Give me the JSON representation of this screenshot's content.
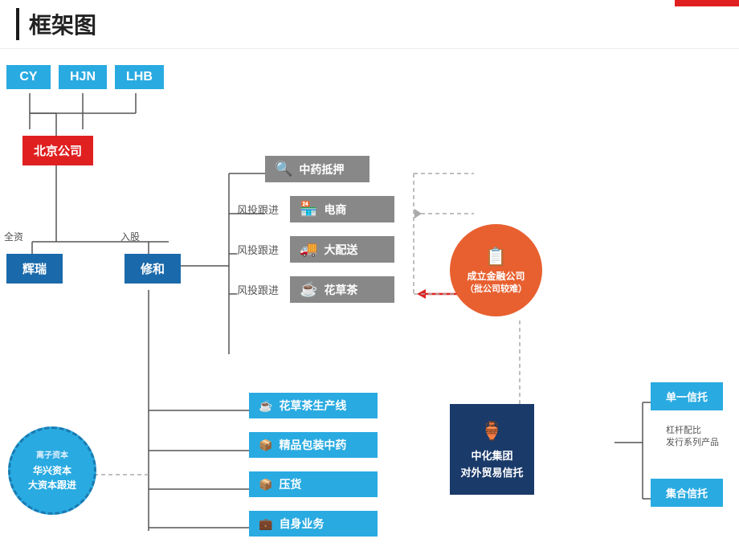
{
  "header": {
    "title": "框架图",
    "accent_color": "#e02020"
  },
  "top_labels": [
    "CY",
    "HJN",
    "LHB"
  ],
  "beijing_box": "北京公司",
  "subsidiaries": {
    "huirui": "辉瑞",
    "xiuhe": "修和",
    "quanzi": "全资",
    "rugu": "入股"
  },
  "business_rows": [
    {
      "label": "",
      "name": "中药抵押",
      "icon": "🔍"
    },
    {
      "label": "风投跟进",
      "name": "电商",
      "icon": "🏪"
    },
    {
      "label": "风投跟进",
      "name": "大配送",
      "icon": "🚚"
    },
    {
      "label": "风投跟进",
      "name": "花草茶",
      "icon": "☕"
    }
  ],
  "bottom_business": [
    {
      "name": "花草茶生产线",
      "icon": "☕"
    },
    {
      "name": "精品包装中药",
      "icon": "📦"
    },
    {
      "name": "压货",
      "icon": "📦"
    },
    {
      "name": "自身业务",
      "icon": "💼"
    }
  ],
  "finance_circle": {
    "icon": "📋",
    "line1": "成立金融公司",
    "line2": "（批公司较难）"
  },
  "huaxing_circle": {
    "line1": "华兴资本",
    "line2": "大资本跟进",
    "subtitle": "离子资本"
  },
  "zhonghua_box": {
    "name": "中化集团\n对外贸易信托"
  },
  "trust_boxes": {
    "single": "单一信托",
    "combined": "集合信托",
    "leverage": "杠杆配比\n发行系列产品"
  }
}
